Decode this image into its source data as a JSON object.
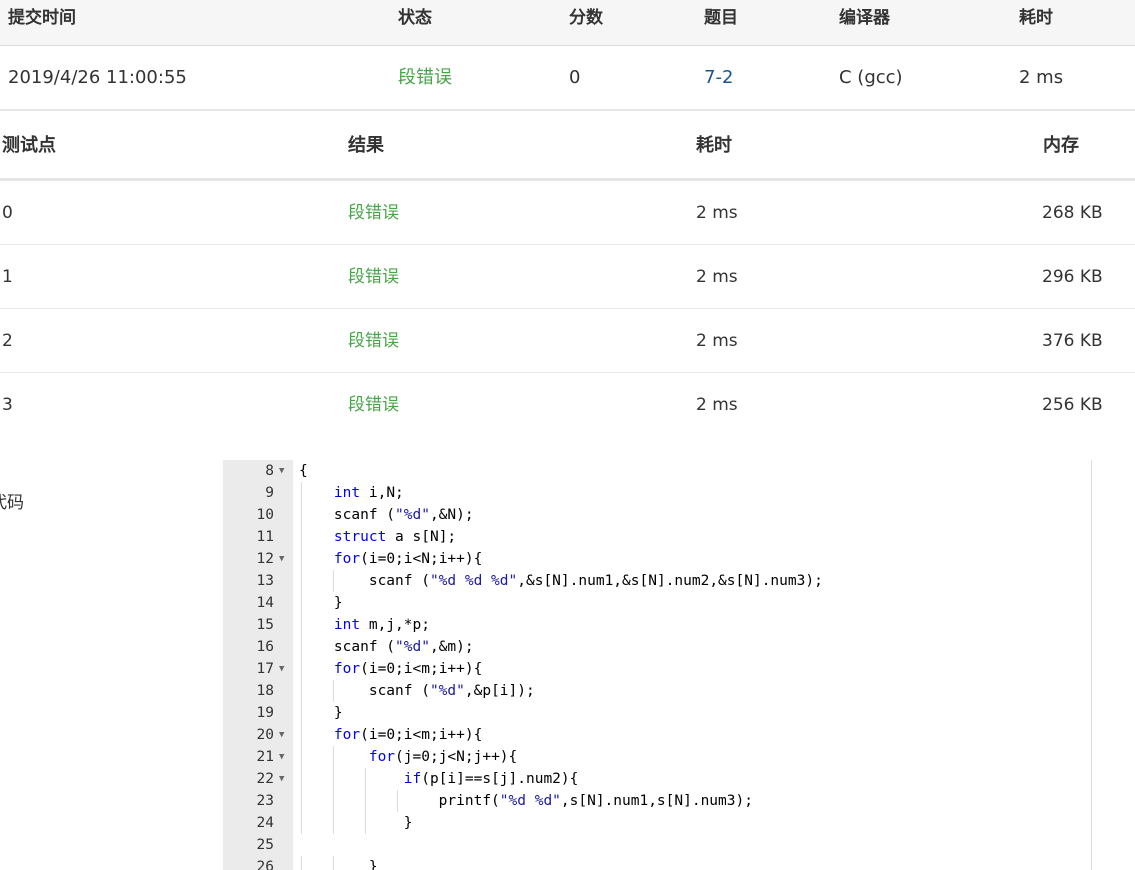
{
  "submission": {
    "headers": [
      "提交时间",
      "状态",
      "分数",
      "题目",
      "编译器",
      "耗时"
    ],
    "row": {
      "time": "2019/4/26 11:00:55",
      "status": "段错误",
      "score": "0",
      "problem": "7-2",
      "compiler": "C (gcc)",
      "duration": "2 ms"
    }
  },
  "tests": {
    "headers": [
      "测试点",
      "结果",
      "耗时",
      "内存"
    ],
    "rows": [
      {
        "id": "0",
        "result": "段错误",
        "time": "2 ms",
        "memory": "268 KB"
      },
      {
        "id": "1",
        "result": "段错误",
        "time": "2 ms",
        "memory": "296 KB"
      },
      {
        "id": "2",
        "result": "段错误",
        "time": "2 ms",
        "memory": "376 KB"
      },
      {
        "id": "3",
        "result": "段错误",
        "time": "2 ms",
        "memory": "256 KB"
      }
    ]
  },
  "code_label": "代码",
  "code_lines": [
    {
      "num": "8",
      "fold": true,
      "text": "{"
    },
    {
      "num": "9",
      "fold": false,
      "text": "    int i,N;"
    },
    {
      "num": "10",
      "fold": false,
      "text": "    scanf (\"%d\",&N);"
    },
    {
      "num": "11",
      "fold": false,
      "text": "    struct a s[N];"
    },
    {
      "num": "12",
      "fold": true,
      "text": "    for(i=0;i<N;i++){"
    },
    {
      "num": "13",
      "fold": false,
      "text": "        scanf (\"%d %d %d\",&s[N].num1,&s[N].num2,&s[N].num3);"
    },
    {
      "num": "14",
      "fold": false,
      "text": "    }"
    },
    {
      "num": "15",
      "fold": false,
      "text": "    int m,j,*p;"
    },
    {
      "num": "16",
      "fold": false,
      "text": "    scanf (\"%d\",&m);"
    },
    {
      "num": "17",
      "fold": true,
      "text": "    for(i=0;i<m;i++){"
    },
    {
      "num": "18",
      "fold": false,
      "text": "        scanf (\"%d\",&p[i]);"
    },
    {
      "num": "19",
      "fold": false,
      "text": "    }"
    },
    {
      "num": "20",
      "fold": true,
      "text": "    for(i=0;i<m;i++){"
    },
    {
      "num": "21",
      "fold": true,
      "text": "        for(j=0;j<N;j++){"
    },
    {
      "num": "22",
      "fold": true,
      "text": "            if(p[i]==s[j].num2){"
    },
    {
      "num": "23",
      "fold": false,
      "text": "                printf(\"%d %d\",s[N].num1,s[N].num3);"
    },
    {
      "num": "24",
      "fold": false,
      "text": "            }"
    },
    {
      "num": "25",
      "fold": false,
      "text": ""
    },
    {
      "num": "26",
      "fold": false,
      "text": "        }"
    }
  ],
  "colors": {
    "status_green": "#47a447",
    "link_blue": "#1a5490",
    "keyword_blue": "#0000ff",
    "string_blue": "#1a1aa6"
  }
}
